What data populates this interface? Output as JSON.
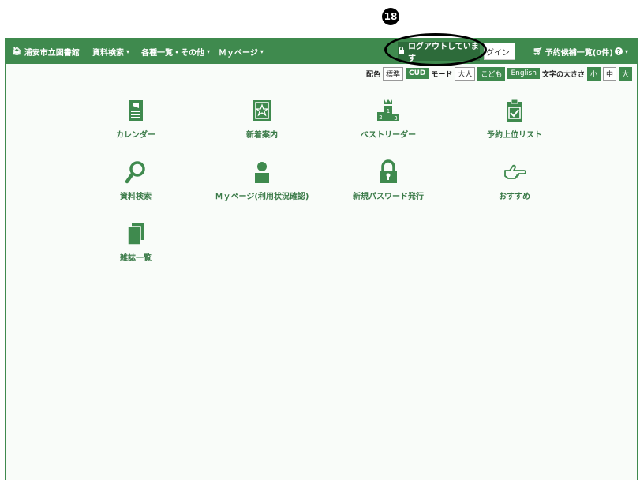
{
  "callout": {
    "number": "18"
  },
  "nav": {
    "home_label": "浦安市立図書館",
    "menus": [
      {
        "label": "資料検索",
        "caret": "▾"
      },
      {
        "label": "各種一覧・その他",
        "caret": "▾"
      },
      {
        "label": "Ｍｙページ",
        "caret": "▾"
      }
    ],
    "logout_label": "ログアウトしています",
    "login_label": "グイン",
    "cart_label": "予約候補一覧(0件)",
    "help_caret": "▾"
  },
  "settings": {
    "color_label": "配色",
    "color_standard": "標準",
    "color_cud": "CUD",
    "mode_label": "モード",
    "mode_adult": "大人",
    "mode_child": "こども",
    "mode_english": "English",
    "fontsize_label": "文字の大きさ",
    "size_small": "小",
    "size_medium": "中",
    "size_large": "大"
  },
  "tiles": [
    {
      "label": "カレンダー",
      "icon": "calendar-icon"
    },
    {
      "label": "新着案内",
      "icon": "new-book-icon"
    },
    {
      "label": "ベストリーダー",
      "icon": "ranking-icon"
    },
    {
      "label": "予約上位リスト",
      "icon": "clipboard-icon"
    },
    {
      "label": "資料検索",
      "icon": "search-icon"
    },
    {
      "label": "Ｍｙページ(利用状況確認)",
      "icon": "user-icon"
    },
    {
      "label": "新規パスワード発行",
      "icon": "lock-icon"
    },
    {
      "label": "おすすめ",
      "icon": "pointing-hand-icon"
    },
    {
      "label": "雑誌一覧",
      "icon": "magazine-icon"
    }
  ],
  "colors": {
    "brand_green": "#3f8a4e",
    "dark_green": "#2d6b3a"
  }
}
